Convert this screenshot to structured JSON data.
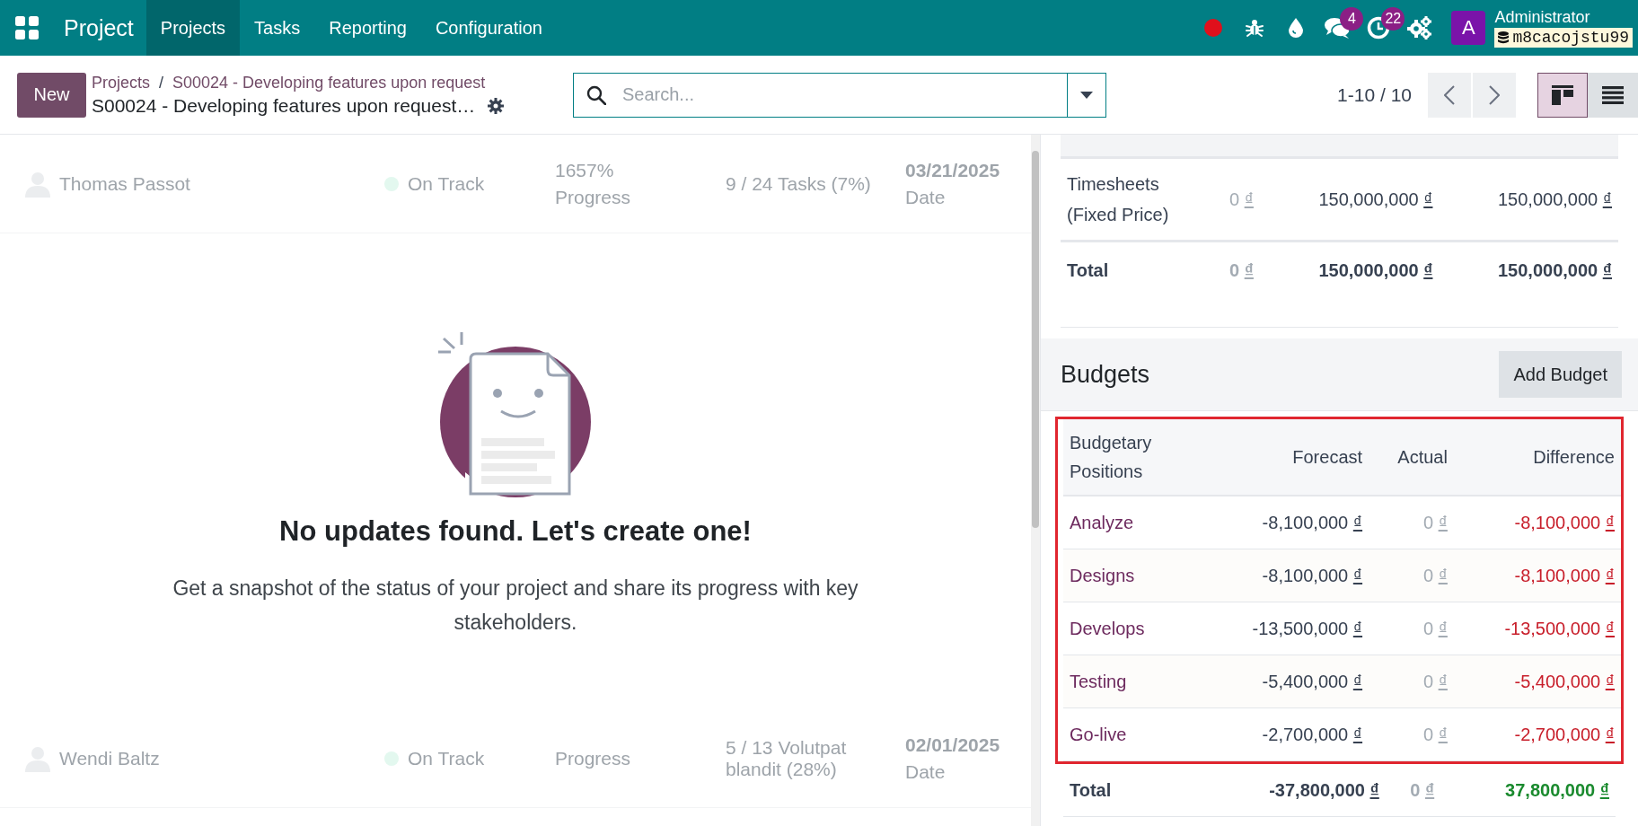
{
  "navbar": {
    "app_name": "Project",
    "menu": [
      {
        "label": "Projects",
        "selected": true
      },
      {
        "label": "Tasks",
        "selected": false
      },
      {
        "label": "Reporting",
        "selected": false
      },
      {
        "label": "Configuration",
        "selected": false
      }
    ],
    "systray": [
      {
        "kind": "record"
      },
      {
        "kind": "bug"
      },
      {
        "kind": "drop"
      },
      {
        "kind": "chat",
        "badge": "4"
      },
      {
        "kind": "clock",
        "badge": "22"
      },
      {
        "kind": "gears"
      }
    ],
    "user": {
      "avatar_letter": "A",
      "name": "Administrator",
      "database": "m8cacojstu99"
    }
  },
  "control_panel": {
    "new_button": "New",
    "breadcrumbs": [
      "Projects",
      "S00024 - Developing features upon request"
    ],
    "breadcrumb_separator": "/",
    "current": "S00024 - Developing features upon request…",
    "search": {
      "placeholder": "Search..."
    },
    "pager": "1-10 / 10",
    "views": [
      {
        "kind": "kanban",
        "selected": true
      },
      {
        "kind": "list",
        "selected": false
      }
    ]
  },
  "background_updates": [
    {
      "assignee": "Thomas Passot",
      "status": "On Track",
      "progress": "1657%",
      "progress_label": "Progress",
      "tasks": "9 / 24 Tasks (7%)",
      "date": "03/21/2025",
      "date_label": "Date"
    },
    {
      "assignee": "Wendi Baltz",
      "status": "On Track",
      "progress_label": "Progress",
      "tasks": "5 / 13 Volutpat blandit (28%)",
      "date": "02/01/2025",
      "date_label": "Date"
    }
  ],
  "empty_state": {
    "title": "No updates found. Let's create one!",
    "text": "Get a snapshot of the status of your project and share its progress with key stakeholders."
  },
  "profitability": {
    "rows": [
      {
        "label": "Timesheets (Fixed Price)",
        "invoiced": "0 ₫",
        "to_invoice": "150,000,000 ₫",
        "expected": "150,000,000 ₫"
      }
    ],
    "total": {
      "label": "Total",
      "invoiced": "0 ₫",
      "to_invoice": "150,000,000 ₫",
      "expected": "150,000,000 ₫"
    }
  },
  "budgets": {
    "title": "Budgets",
    "add_button": "Add Budget",
    "highlighted": true,
    "columns": [
      "Budgetary Positions",
      "Forecast",
      "Actual",
      "Difference"
    ],
    "rows": [
      {
        "name": "Analyze",
        "forecast": "-8,100,000 ₫",
        "actual": "0 ₫",
        "difference": "-8,100,000 ₫",
        "color": "#c81e2a"
      },
      {
        "name": "Designs",
        "forecast": "-8,100,000 ₫",
        "actual": "0 ₫",
        "difference": "-8,100,000 ₫",
        "color": "#c81e2a"
      },
      {
        "name": "Develops",
        "forecast": "-13,500,000 ₫",
        "actual": "0 ₫",
        "difference": "-13,500,000 ₫",
        "color": "#c81e2a"
      },
      {
        "name": "Testing",
        "forecast": "-5,400,000 ₫",
        "actual": "0 ₫",
        "difference": "-5,400,000 ₫",
        "color": "#c81e2a"
      },
      {
        "name": "Go-live",
        "forecast": "-2,700,000 ₫",
        "actual": "0 ₫",
        "difference": "-2,700,000 ₫",
        "color": "#c81e2a"
      }
    ],
    "total": {
      "name": "Total",
      "forecast": "-37,800,000 ₫",
      "actual": "0 ₫",
      "difference": "37,800,000 ₫",
      "color": "#1a8a2e"
    }
  }
}
